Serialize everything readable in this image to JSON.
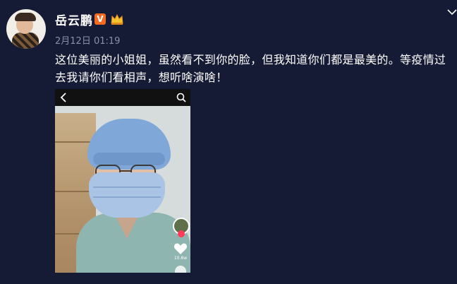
{
  "post": {
    "username": "岳云鹏",
    "verified_badge": "V",
    "crown_icon": "crown-icon",
    "timestamp": "2月12日 01:19",
    "text": "这位美丽的小姐姐，虽然看不到你的脸，但我知道你们都是最美的。等疫情过去我请你们看相声，想听啥演啥！"
  },
  "video": {
    "like_count": "10.8w",
    "icons": [
      "back-icon",
      "search-icon",
      "heart-icon"
    ]
  },
  "colors": {
    "background": "#151a35",
    "text": "#ffffff",
    "muted": "#8a90a8",
    "verified": "#f46a22"
  }
}
